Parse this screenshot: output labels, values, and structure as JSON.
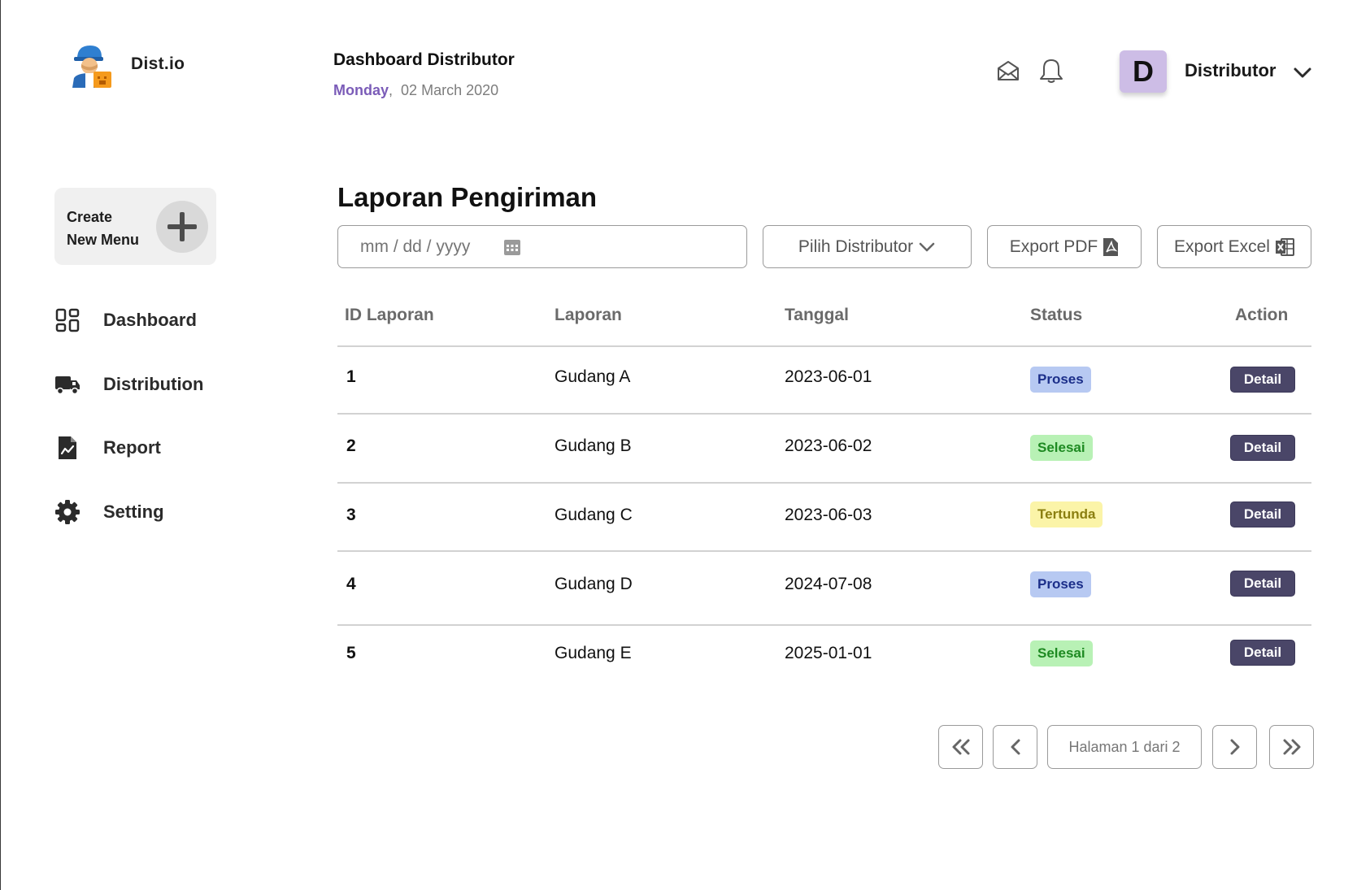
{
  "brand": {
    "name": "Dist.io"
  },
  "header": {
    "title": "Dashboard Distributor",
    "day": "Monday",
    "separator": ",",
    "date": "02 March 2020"
  },
  "user": {
    "initial": "D",
    "name": "Distributor"
  },
  "sidebar": {
    "create_line1": "Create",
    "create_line2": "New Menu",
    "items": [
      {
        "label": "Dashboard",
        "icon": "dashboard-icon"
      },
      {
        "label": "Distribution",
        "icon": "truck-icon"
      },
      {
        "label": "Report",
        "icon": "report-icon"
      },
      {
        "label": "Setting",
        "icon": "gear-icon"
      }
    ]
  },
  "main": {
    "title": "Laporan Pengiriman",
    "filters": {
      "date_placeholder": "mm / dd / yyyy",
      "distributor_select": "Pilih Distributor",
      "export_pdf": "Export PDF",
      "export_excel": "Export Excel"
    },
    "table": {
      "columns": [
        "ID Laporan",
        "Laporan",
        "Tanggal",
        "Status",
        "Action"
      ],
      "rows": [
        {
          "id": "1",
          "laporan": "Gudang A",
          "tanggal": "2023-06-01",
          "status": "Proses",
          "action": "Detail"
        },
        {
          "id": "2",
          "laporan": "Gudang B",
          "tanggal": "2023-06-02",
          "status": "Selesai",
          "action": "Detail"
        },
        {
          "id": "3",
          "laporan": "Gudang C",
          "tanggal": "2023-06-03",
          "status": "Tertunda",
          "action": "Detail"
        },
        {
          "id": "4",
          "laporan": "Gudang D",
          "tanggal": "2024-07-08",
          "status": "Proses",
          "action": "Detail"
        },
        {
          "id": "5",
          "laporan": "Gudang E",
          "tanggal": "2025-01-01",
          "status": "Selesai",
          "action": "Detail"
        }
      ]
    },
    "pagination": {
      "info": "Halaman 1 dari 2"
    }
  },
  "colors": {
    "accent_purple": "#7b5cb8",
    "avatar_bg": "#cdbde6",
    "detail_button": "#4a4668",
    "status_proses": "#b7c9f2",
    "status_selesai": "#b8f1b5",
    "status_tertunda": "#fbf4a8"
  }
}
